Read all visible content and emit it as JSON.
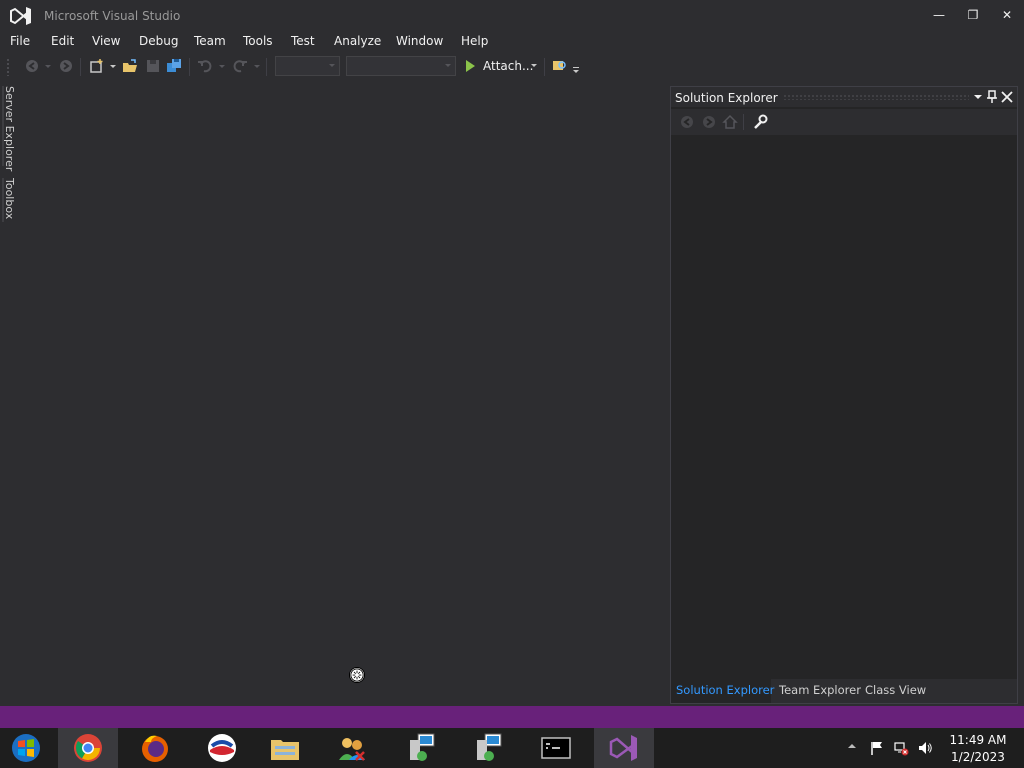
{
  "window": {
    "title": "Microsoft Visual Studio",
    "minimize_glyph": "—",
    "maximize_glyph": "❐",
    "close_glyph": "✕"
  },
  "menu": [
    "File",
    "Edit",
    "View",
    "Debug",
    "Team",
    "Tools",
    "Test",
    "Analyze",
    "Window",
    "Help"
  ],
  "toolbar": {
    "attach_label": "Attach...",
    "icons": [
      "back-icon",
      "forward-icon",
      "new-project-icon",
      "open-file-icon",
      "save-icon",
      "save-all-icon",
      "undo-icon",
      "redo-icon",
      "find-in-files-icon"
    ]
  },
  "side_tabs": {
    "server_explorer": "Server Explorer",
    "toolbox": "Toolbox"
  },
  "solution_explorer": {
    "title": "Solution Explorer",
    "tabs": [
      "Solution Explorer",
      "Team Explorer",
      "Class View"
    ],
    "active_tab": "Solution Explorer"
  },
  "taskbar": {
    "apps": [
      "start-orb-icon",
      "chrome-icon",
      "firefox-icon",
      "obama-logo-icon",
      "file-explorer-icon",
      "network-users-icon",
      "remote-desktop-icon",
      "remote-desktop-icon",
      "command-prompt-icon",
      "visual-studio-icon"
    ],
    "time": "11:49 AM",
    "date": "1/2/2023"
  },
  "colors": {
    "accent": "#68217a",
    "background": "#2d2d30",
    "panel": "#252526",
    "link_blue": "#3399ff"
  }
}
